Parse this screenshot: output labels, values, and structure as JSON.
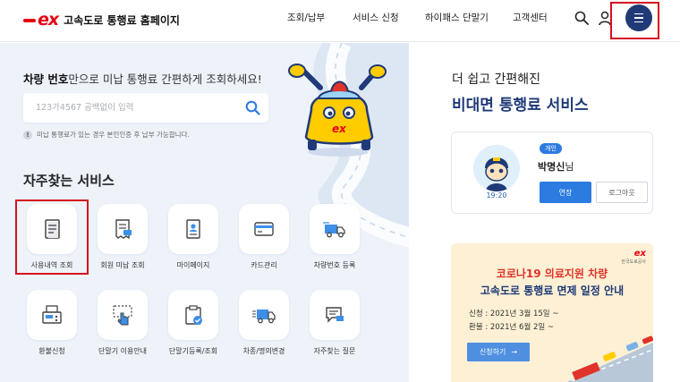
{
  "header": {
    "logo_mark": "ex",
    "logo_text": "고속도로 통행료 홈페이지",
    "nav": [
      "조회/납부",
      "서비스 신청",
      "하이패스 단말기",
      "고객센터"
    ],
    "icons": [
      "search-icon",
      "user-icon",
      "hamburger-menu-icon"
    ]
  },
  "query": {
    "title_bold": "차량 번호",
    "title_rest": "만으로 미납 통행료 간편하게 조회하세요!",
    "placeholder": "123가4567 공백없이 입력",
    "notice": "미납 통행료가 있는 경우 본인인증 후 납부 가능합니다."
  },
  "services": {
    "title": "자주찾는 서비스",
    "items": [
      {
        "label": "사용내역 조회",
        "icon": "receipt-icon"
      },
      {
        "label": "회원 미납 조회",
        "icon": "bill-icon"
      },
      {
        "label": "마이페이지",
        "icon": "id-card-icon"
      },
      {
        "label": "카드관리",
        "icon": "credit-card-icon"
      },
      {
        "label": "차량번호 등록",
        "icon": "truck-icon"
      },
      {
        "label": "환불신청",
        "icon": "register-icon"
      },
      {
        "label": "단말기 이용안내",
        "icon": "touch-icon"
      },
      {
        "label": "단말기등록/조회",
        "icon": "clipboard-check-icon"
      },
      {
        "label": "차종/명의변경",
        "icon": "truck-swap-icon"
      },
      {
        "label": "자주찾는 질문",
        "icon": "chat-icon"
      }
    ]
  },
  "promo": {
    "subtitle": "더 쉽고 간편해진",
    "title": "비대면 통행료 서비스"
  },
  "user_card": {
    "badge": "개인",
    "name": "박명신",
    "suffix": "님",
    "time": "19:20",
    "extend_label": "연장",
    "logout_label": "로그아웃"
  },
  "banner": {
    "logo_mark": "ex",
    "logo_sub": "한국도로공사",
    "title1": "코로나19 의료지원 차량",
    "title2": "고속도로 통행료 면제 일정 안내",
    "date1": "신청 : 2021년 3월 15일 ~",
    "date2": "환불 : 2021년 6월 2일 ~",
    "button": "신청하기",
    "button_arrow": "→"
  },
  "colors": {
    "brand_red": "#e60012",
    "navy": "#1f3a77",
    "blue": "#2b7be0",
    "highlight_box": "#d5101e"
  }
}
